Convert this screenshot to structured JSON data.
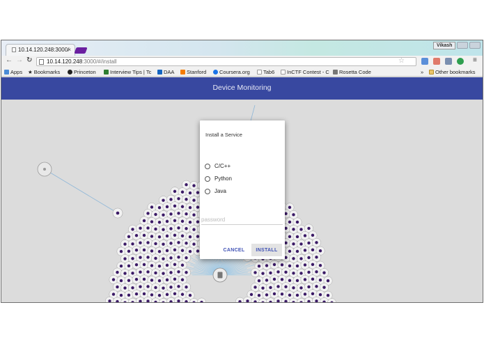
{
  "browser": {
    "tab_title": "10.14.120.248:3000/",
    "tab_close": "×",
    "user": "Vikash",
    "url_host": "10.14.120.248",
    "url_path": ":3000/#/install",
    "bookmarks": [
      {
        "label": "Apps",
        "icon": "apps-grid-icon",
        "color": "#4a8bd6"
      },
      {
        "label": "Bookmarks",
        "icon": "star-icon",
        "color": "#555555"
      },
      {
        "label": "Princeton",
        "icon": "princeton-icon",
        "color": "#222222"
      },
      {
        "label": "Interview Tips | Tc",
        "icon": "tips-icon",
        "color": "#2e7d32"
      },
      {
        "label": "DAA",
        "icon": "daa-icon",
        "color": "#1565c0"
      },
      {
        "label": "Stanford",
        "icon": "stanford-icon",
        "color": "#f57c00"
      },
      {
        "label": "Coursera.org",
        "icon": "coursera-icon",
        "color": "#1a73e8"
      },
      {
        "label": "Tab6",
        "icon": "page-icon",
        "color": "#999999"
      },
      {
        "label": "InCTF Contest - C",
        "icon": "page-icon",
        "color": "#999999"
      },
      {
        "label": "Rosetta Code",
        "icon": "rosetta-icon",
        "color": "#555555"
      }
    ],
    "overflow": "»",
    "other_bookmarks": "Other bookmarks"
  },
  "app": {
    "title": "Device Monitoring",
    "accent_color": "#3848a0"
  },
  "dialog": {
    "title": "Install a Service",
    "options": [
      "C/C++",
      "Python",
      "Java"
    ],
    "password_placeholder": "password",
    "cancel_label": "CANCEL",
    "install_label": "INSTALL"
  }
}
